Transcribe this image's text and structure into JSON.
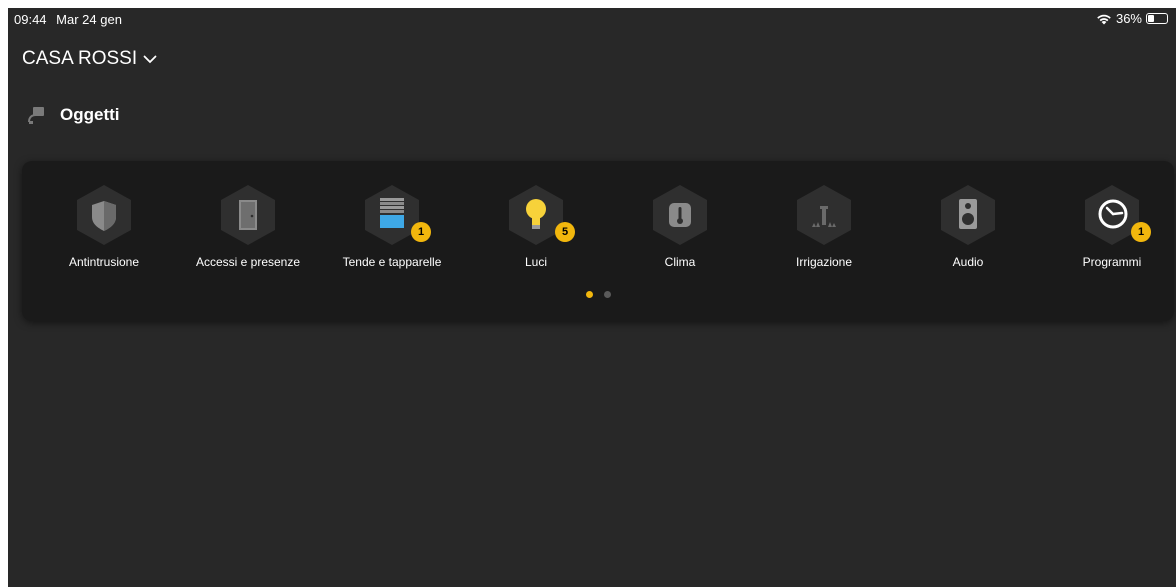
{
  "status_bar": {
    "time": "09:44",
    "date": "Mar 24 gen",
    "battery": "36%",
    "battery_level": 0.36,
    "wifi_icon": "wifi-icon"
  },
  "home": {
    "name": "CASA ROSSI",
    "chevron_icon": "chevron-down-icon"
  },
  "section": {
    "title": "Oggetti",
    "icon": "objects-icon"
  },
  "tiles": [
    {
      "label": "Antintrusione",
      "icon": "shield-icon",
      "badge": ""
    },
    {
      "label": "Accessi e presenze",
      "icon": "door-icon",
      "badge": ""
    },
    {
      "label": "Tende e tapparelle",
      "icon": "blinds-icon",
      "badge": "1"
    },
    {
      "label": "Luci",
      "icon": "lightbulb-icon",
      "badge": "5"
    },
    {
      "label": "Clima",
      "icon": "thermometer-icon",
      "badge": ""
    },
    {
      "label": "Irrigazione",
      "icon": "sprinkler-icon",
      "badge": ""
    },
    {
      "label": "Audio",
      "icon": "speaker-icon",
      "badge": ""
    },
    {
      "label": "Programmi",
      "icon": "clock-icon",
      "badge": "1"
    }
  ],
  "pager": {
    "pages": 2,
    "active": 1
  },
  "colors": {
    "background": "#282828",
    "card": "#1a1a1a",
    "accent": "#f2b70d",
    "hex": "#2f2f2f",
    "dot_inactive": "#5a5a5a"
  }
}
